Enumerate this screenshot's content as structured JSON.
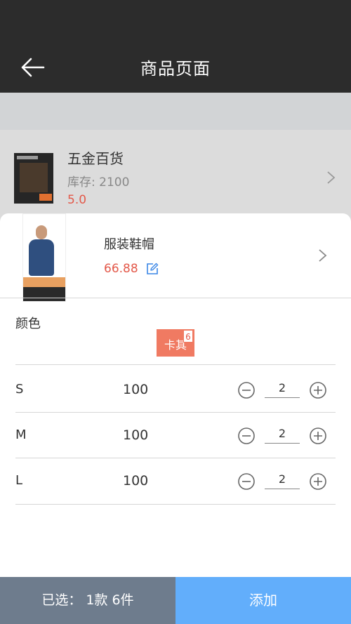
{
  "header": {
    "title": "商品页面"
  },
  "background_item": {
    "name": "五金百货",
    "stock": "库存: 2100",
    "rating": "5.0"
  },
  "product": {
    "name": "服装鞋帽",
    "price": "66.88"
  },
  "color_section": {
    "label": "颜色",
    "chip_label": "卡其",
    "chip_badge": "6"
  },
  "sizes": [
    {
      "size": "S",
      "stock": "100",
      "qty": "2"
    },
    {
      "size": "M",
      "stock": "100",
      "qty": "2"
    },
    {
      "size": "L",
      "stock": "100",
      "qty": "2"
    }
  ],
  "footer": {
    "selected": "已选： 1款 6件",
    "add_label": "添加"
  },
  "colors": {
    "accent_red": "#e3594a",
    "chip_bg": "#f07a62",
    "add_button": "#62aefb",
    "summary_bg": "#6e7c8d",
    "nav_bg": "#2c2c2c",
    "edit_icon": "#3a86e6"
  }
}
